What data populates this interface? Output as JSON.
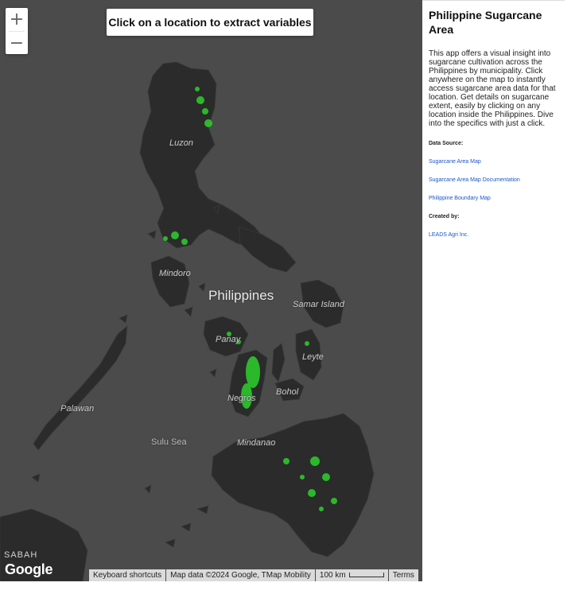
{
  "map": {
    "zoom_in_label": "+",
    "zoom_out_label": "−",
    "extract_banner": "Click on a location to extract variables",
    "places": {
      "luzon": "Luzon",
      "mindoro": "Mindoro",
      "philippines": "Philippines",
      "samar": "Samar Island",
      "panay": "Panay",
      "leyte": "Leyte",
      "negros": "Negros",
      "bohol": "Bohol",
      "palawan": "Palawan",
      "sulu_sea": "Sulu Sea",
      "mindanao": "Mindanao",
      "sabah": "SABAH"
    },
    "google_logo": "Google",
    "attribution": {
      "keyboard": "Keyboard shortcuts",
      "map_data": "Map data ©2024 Google, TMap Mobility",
      "scale": "100 km",
      "terms": "Terms"
    },
    "colors": {
      "land": "#2b2b2b",
      "water": "#4b4b4b",
      "sugarcane": "#2bd12b"
    }
  },
  "panel": {
    "title": "Philippine Sugarcane Area",
    "description": "This app offers a visual insight into sugarcane cultivation across the Philippines by municipality. Click anywhere on the map to instantly access sugarcane area data for that location. Get details on sugarcane extent, easily by clicking on any location inside the Philippines. Dive into the specifics with just a click.",
    "data_source_label": "Data Source:",
    "links": [
      "Sugarcane Area Map",
      "Sugarcane Area Map Documentation",
      "Philippine Boundary Map"
    ],
    "created_by_label": "Created by:",
    "author": "LEADS Agri Inc.",
    "link_color": "#1a56c8"
  }
}
